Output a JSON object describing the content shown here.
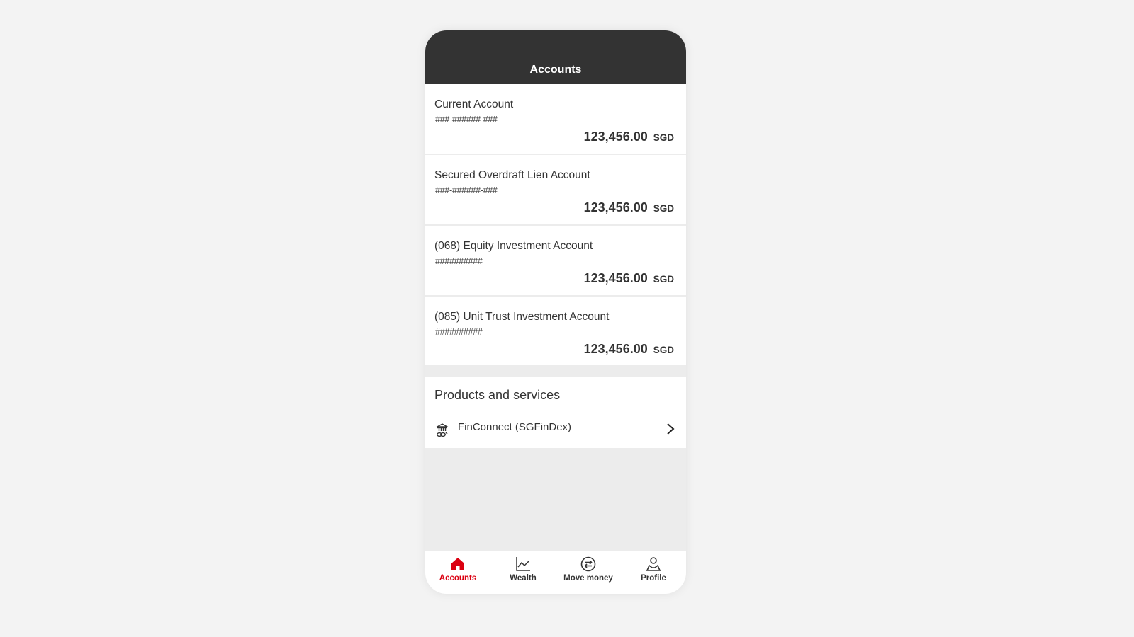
{
  "header": {
    "title": "Accounts"
  },
  "accounts": [
    {
      "name": "Current Account",
      "number": "###-######-###",
      "amount": "123,456.00",
      "currency": "SGD"
    },
    {
      "name": "Secured Overdraft Lien Account",
      "number": "###-######-###",
      "amount": "123,456.00",
      "currency": "SGD"
    },
    {
      "name": "(068) Equity Investment Account",
      "number": "##########",
      "amount": "123,456.00",
      "currency": "SGD"
    },
    {
      "name": "(085) Unit Trust Investment Account",
      "number": "##########",
      "amount": "123,456.00",
      "currency": "SGD"
    }
  ],
  "products": {
    "title": "Products and services",
    "items": [
      {
        "label": "FinConnect (SGFinDex)",
        "icon": "bank-link-icon"
      }
    ]
  },
  "tabbar": {
    "active": "accounts",
    "accent": "#db0011",
    "items": [
      {
        "label": "Accounts",
        "icon": "home-icon"
      },
      {
        "label": "Wealth",
        "icon": "chart-line-icon"
      },
      {
        "label": "Move money",
        "icon": "transfer-icon"
      },
      {
        "label": "Profile",
        "icon": "user-icon"
      }
    ]
  }
}
